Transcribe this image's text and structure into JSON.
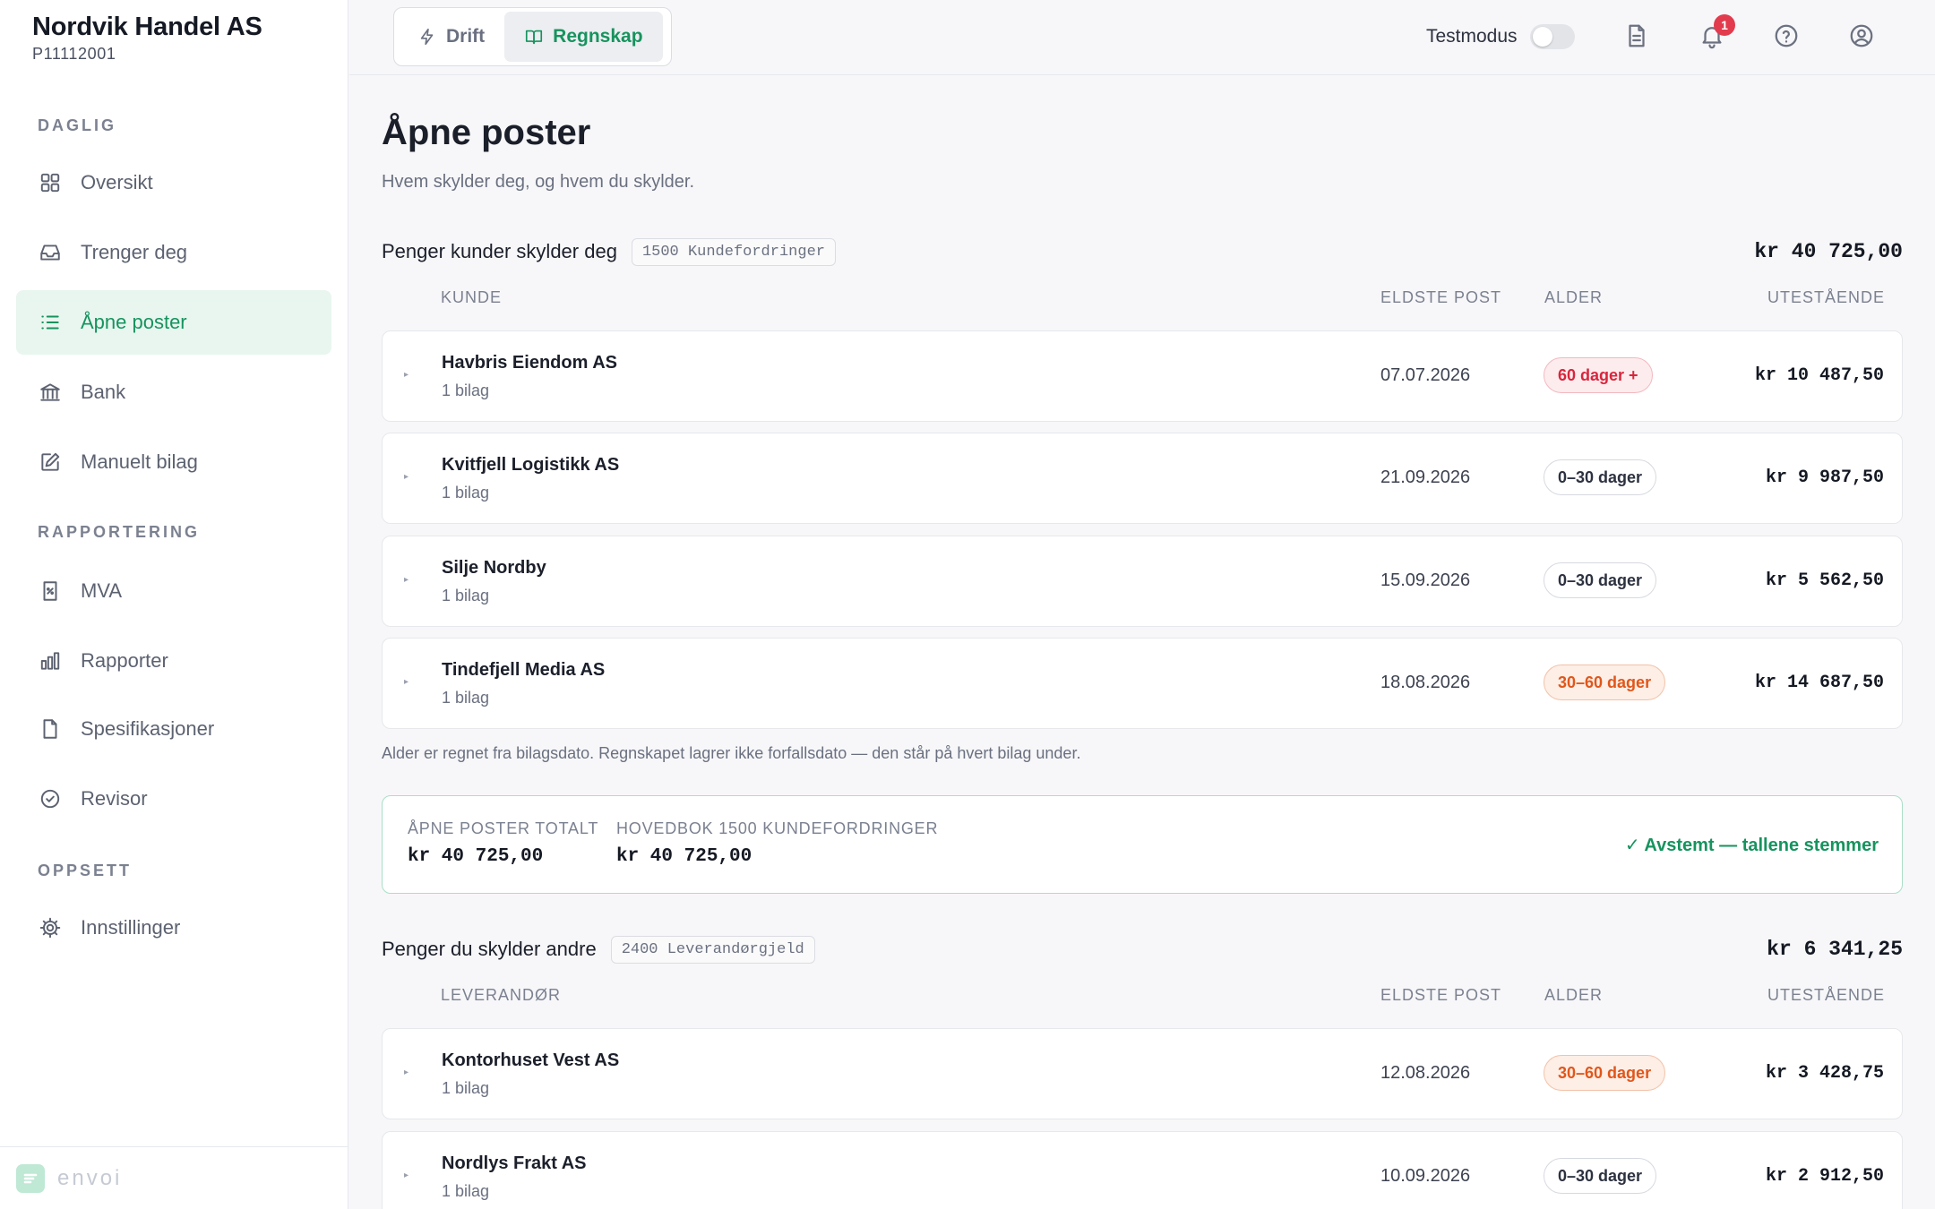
{
  "company": {
    "name": "Nordvik Handel AS",
    "id": "P11112001"
  },
  "sidebar": {
    "sections": [
      {
        "label": "DAGLIG"
      },
      {
        "label": "RAPPORTERING"
      },
      {
        "label": "OPPSETT"
      }
    ],
    "items": [
      {
        "label": "Oversikt",
        "icon": "grid-icon"
      },
      {
        "label": "Trenger deg",
        "icon": "inbox-icon"
      },
      {
        "label": "Åpne poster",
        "icon": "list-icon",
        "active": true
      },
      {
        "label": "Bank",
        "icon": "bank-icon"
      },
      {
        "label": "Manuelt bilag",
        "icon": "edit-icon"
      },
      {
        "label": "MVA",
        "icon": "receipt-icon"
      },
      {
        "label": "Rapporter",
        "icon": "bar-chart-icon"
      },
      {
        "label": "Spesifikasjoner",
        "icon": "file-icon"
      },
      {
        "label": "Revisor",
        "icon": "check-circle-icon"
      },
      {
        "label": "Innstillinger",
        "icon": "gear-icon"
      }
    ],
    "footer_brand": "envoi"
  },
  "topbar": {
    "tabs": [
      {
        "label": "Drift",
        "icon": "bolt-icon"
      },
      {
        "label": "Regnskap",
        "icon": "book-icon",
        "active": true
      }
    ],
    "testmode_label": "Testmodus",
    "notification_count": "1"
  },
  "page": {
    "title": "Åpne poster",
    "subtitle": "Hvem skylder deg, og hvem du skylder."
  },
  "receivables": {
    "title": "Penger kunder skylder deg",
    "account": "1500 Kundefordringer",
    "total": "kr 40 725,00",
    "columns": {
      "party": "KUNDE",
      "oldest": "ELDSTE POST",
      "age": "ALDER",
      "outstanding": "UTESTÅENDE"
    },
    "rows": [
      {
        "name": "Havbris Eiendom AS",
        "count": "1 bilag",
        "date": "07.07.2026",
        "age": "60 dager +",
        "age_level": "red",
        "amount": "kr 10 487,50"
      },
      {
        "name": "Kvitfjell Logistikk AS",
        "count": "1 bilag",
        "date": "21.09.2026",
        "age": "0–30 dager",
        "age_level": "gray",
        "amount": "kr 9 987,50"
      },
      {
        "name": "Silje Nordby",
        "count": "1 bilag",
        "date": "15.09.2026",
        "age": "0–30 dager",
        "age_level": "gray",
        "amount": "kr 5 562,50"
      },
      {
        "name": "Tindefjell Media AS",
        "count": "1 bilag",
        "date": "18.08.2026",
        "age": "30–60 dager",
        "age_level": "orange",
        "amount": "kr 14 687,50"
      }
    ],
    "note": "Alder er regnet fra bilagsdato. Regnskapet lagrer ikke forfallsdato — den står på hvert bilag under.",
    "reconciliation": {
      "open_label": "ÅPNE POSTER TOTALT",
      "open_value": "kr 40 725,00",
      "ledger_label": "HOVEDBOK 1500 KUNDEFORDRINGER",
      "ledger_value": "kr 40 725,00",
      "status": "✓ Avstemt — tallene stemmer"
    }
  },
  "payables": {
    "title": "Penger du skylder andre",
    "account": "2400 Leverandørgjeld",
    "total": "kr 6 341,25",
    "columns": {
      "party": "LEVERANDØR",
      "oldest": "ELDSTE POST",
      "age": "ALDER",
      "outstanding": "UTESTÅENDE"
    },
    "rows": [
      {
        "name": "Kontorhuset Vest AS",
        "count": "1 bilag",
        "date": "12.08.2026",
        "age": "30–60 dager",
        "age_level": "orange",
        "amount": "kr 3 428,75"
      },
      {
        "name": "Nordlys Frakt AS",
        "count": "1 bilag",
        "date": "10.09.2026",
        "age": "0–30 dager",
        "age_level": "gray",
        "amount": "kr 2 912,50"
      }
    ]
  },
  "colors": {
    "accent": "#17935e",
    "active_bg": "#e8f6ef",
    "danger": "#d7263d",
    "warning": "#e0571b"
  }
}
